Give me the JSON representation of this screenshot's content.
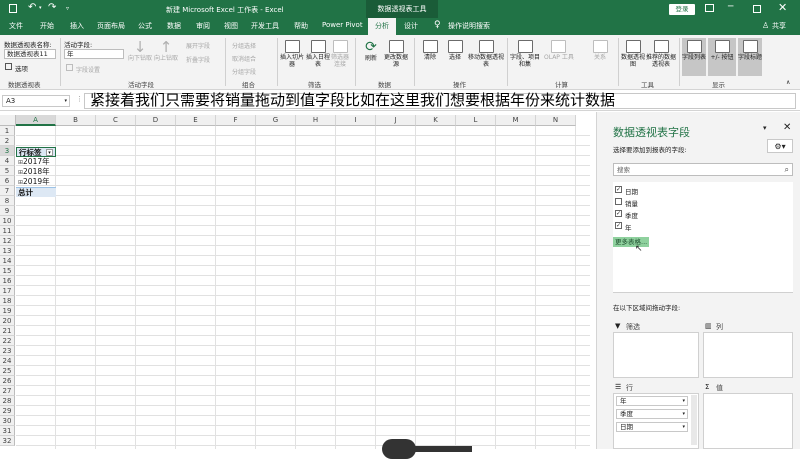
{
  "titlebar": {
    "title": "新建 Microsoft Excel 工作表 - Excel",
    "context_tool": "数据透视表工具",
    "login_label": "登录"
  },
  "tabs": [
    "文件",
    "开始",
    "插入",
    "页面布局",
    "公式",
    "数据",
    "审阅",
    "视图",
    "开发工具",
    "帮助",
    "Power Pivot",
    "分析",
    "设计"
  ],
  "active_tab": "分析",
  "tell_me": "操作说明搜索",
  "share": "共享",
  "ribbon": {
    "pivot_name_label": "数据透视表名称:",
    "pivot_name_value": "数据透视表11",
    "options_label": "选项",
    "group_pivot": "数据透视表",
    "active_field_label": "活动字段:",
    "active_field_value": "年",
    "field_settings": "字段设置",
    "drill_down": "向下钻取",
    "drill_up": "向上钻取",
    "expand_field": "展开字段",
    "collapse_field": "折叠字段",
    "group_active": "活动字段",
    "group_selection": "分组选择",
    "ungroup": "取消组合",
    "group_field": "分组字段",
    "group_group": "组合",
    "insert_slicer": "插入切片器",
    "insert_timeline": "插入日程表",
    "filter_connections": "筛选器连接",
    "group_filter": "筛选",
    "refresh": "刷新",
    "change_source": "更改数据源",
    "group_data": "数据",
    "clear": "清除",
    "select": "选择",
    "move_pivot": "移动数据透视表",
    "group_actions": "操作",
    "fields_items": "字段、项目和集",
    "olap_tools": "OLAP 工具",
    "relationships": "关系",
    "group_calc": "计算",
    "pivot_chart": "数据透视图",
    "recommended_pivot": "推荐的数据透视表",
    "group_tools": "工具",
    "field_list": "字段列表",
    "plus_minus": "+/- 按钮",
    "field_headers": "字段标题",
    "group_show": "显示"
  },
  "formula_bar": {
    "name_box": "A3",
    "caption": "紧接着我们只需要将销量拖动到值字段比如在这里我们想要根据年份来统计数据"
  },
  "columns": [
    "A",
    "B",
    "C",
    "D",
    "E",
    "F",
    "G",
    "H",
    "I",
    "J",
    "K",
    "L",
    "M",
    "N"
  ],
  "rows": [
    "1",
    "2",
    "3",
    "4",
    "5",
    "6",
    "7",
    "8",
    "9",
    "10",
    "11",
    "12",
    "13",
    "14",
    "15",
    "16",
    "17",
    "18",
    "19",
    "20",
    "21",
    "22",
    "23",
    "24",
    "25",
    "26",
    "27",
    "28",
    "29",
    "30",
    "31",
    "32"
  ],
  "pivot_table": {
    "header": "行标签",
    "items": [
      "2017年",
      "2018年",
      "2019年"
    ],
    "total": "总计"
  },
  "panel": {
    "title": "数据透视表字段",
    "subtitle": "选择要添加到报表的字段:",
    "search_placeholder": "搜索",
    "fields": [
      {
        "name": "日期",
        "checked": true
      },
      {
        "name": "销量",
        "checked": false
      },
      {
        "name": "季度",
        "checked": true
      },
      {
        "name": "年",
        "checked": true
      }
    ],
    "more_tables": "更多表格...",
    "drag_hint": "在以下区域间拖动字段:",
    "area_filter": "筛选",
    "area_columns": "列",
    "area_rows": "行",
    "area_values": "值",
    "row_items": [
      "年",
      "季度",
      "日期"
    ]
  }
}
